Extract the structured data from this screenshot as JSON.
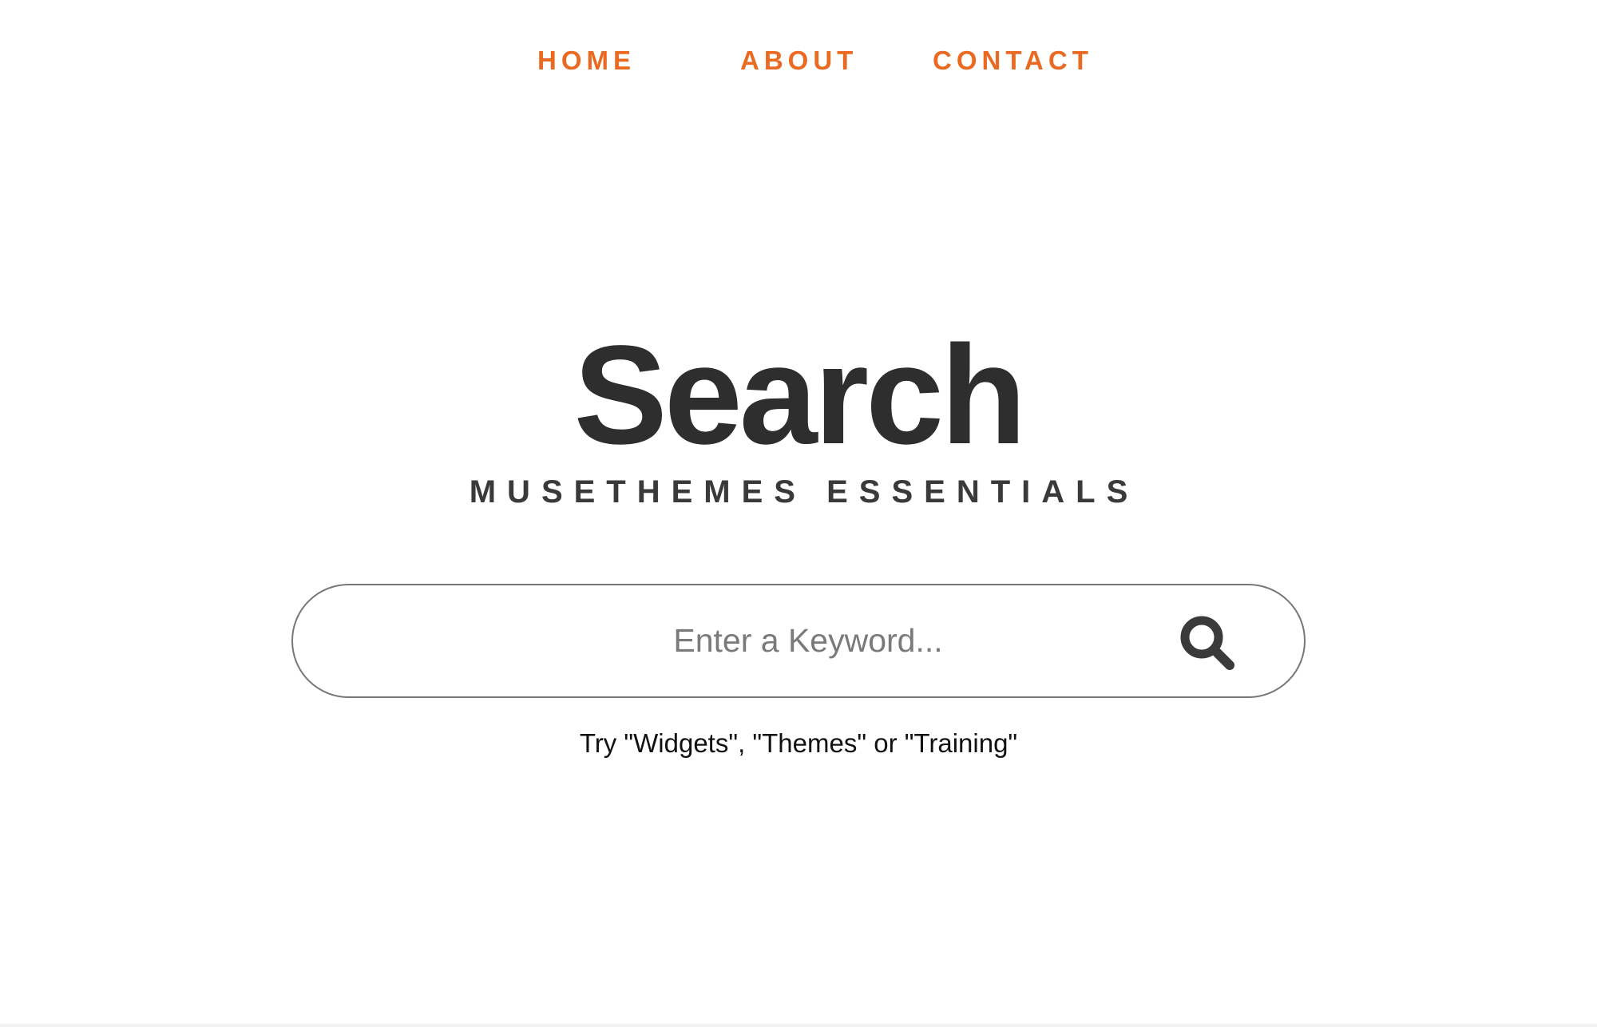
{
  "nav": {
    "items": [
      {
        "label": "HOME"
      },
      {
        "label": "ABOUT"
      },
      {
        "label": "CONTACT"
      }
    ]
  },
  "hero": {
    "title": "Search",
    "subtitle": "MUSETHEMES ESSENTIALS"
  },
  "search": {
    "placeholder": "Enter a Keyword...",
    "value": "",
    "button_icon": "search-icon",
    "hint": "Try \"Widgets\", \"Themes\" or \"Training\""
  },
  "colors": {
    "accent": "#ea6a22",
    "title": "#2e2e2e",
    "border": "#777777",
    "icon": "#3a3a3a"
  }
}
